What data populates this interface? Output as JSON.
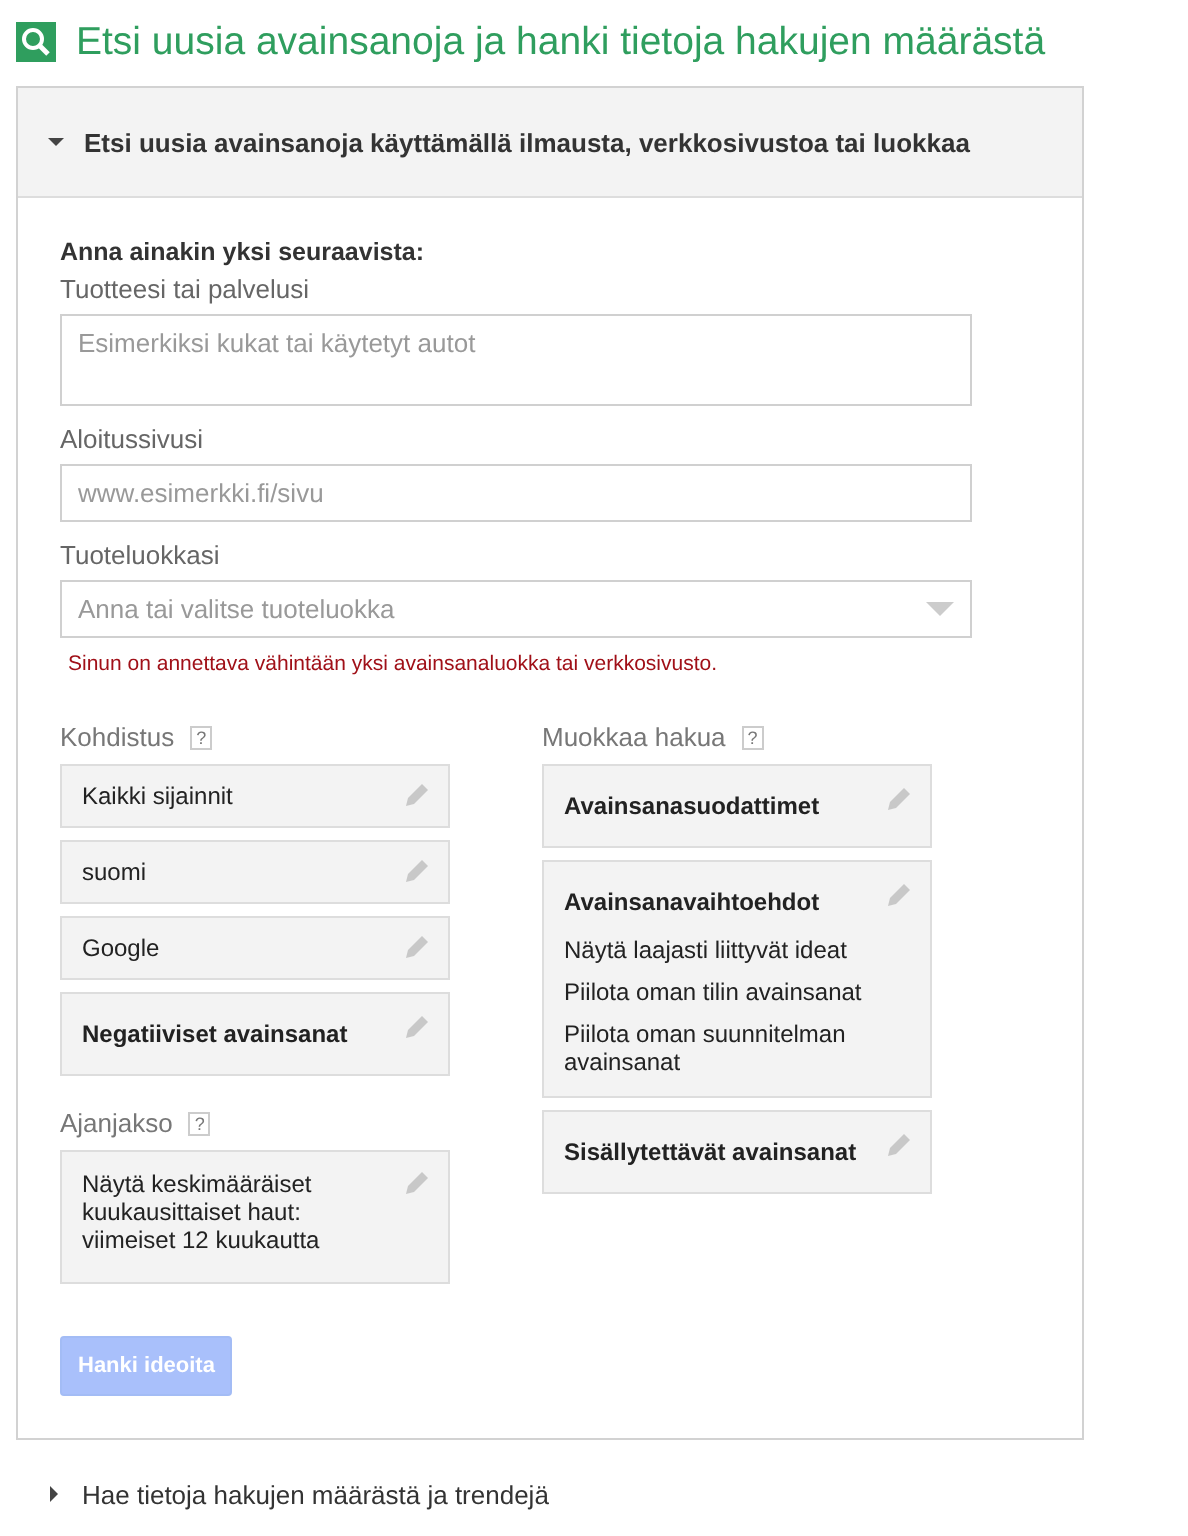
{
  "page_title": "Etsi uusia avainsanoja ja hanki tietoja hakujen määrästä",
  "sections": [
    {
      "title": "Etsi uusia avainsanoja käyttämällä ilmausta, verkkosivustoa tai luokkaa",
      "expanded": true
    },
    {
      "title": "Hae tietoja hakujen määrästä ja trendejä",
      "expanded": false
    }
  ],
  "form": {
    "intro": "Anna ainakin yksi seuraavista:",
    "fields": [
      {
        "kind": "textarea",
        "label": "Tuotteesi tai palvelusi",
        "placeholder": "Esimerkiksi kukat tai käytetyt autot"
      },
      {
        "kind": "input",
        "label": "Aloitussivusi",
        "placeholder": "www.esimerkki.fi/sivu"
      },
      {
        "kind": "dropdown",
        "label": "Tuoteluokkasi",
        "placeholder": "Anna tai valitse tuoteluokka"
      }
    ],
    "error": "Sinun on annettava vähintään yksi avainsanaluokka tai verkkosivusto."
  },
  "columns": [
    [
      {
        "title": "Kohdistus",
        "help": "?",
        "cards": [
          {
            "kind": "value",
            "text": "Kaikki sijainnit"
          },
          {
            "kind": "value",
            "text": "suomi"
          },
          {
            "kind": "value",
            "text": "Google"
          },
          {
            "kind": "heading",
            "text": "Negatiiviset avainsanat"
          }
        ]
      },
      {
        "title": "Ajanjakso",
        "help": "?",
        "cards": [
          {
            "kind": "paragraph",
            "text": "Näytä keskimääräiset kuukausittaiset haut: viimeiset 12 kuukautta"
          }
        ]
      }
    ],
    [
      {
        "title": "Muokkaa hakua",
        "help": "?",
        "cards": [
          {
            "kind": "heading",
            "text": "Avainsanasuodattimet"
          },
          {
            "kind": "heading",
            "text": "Avainsanavaihtoehdot",
            "lines": [
              "Näytä laajasti liittyvät ideat",
              "Piilota oman tilin avainsanat",
              "Piilota oman suunnitelman avainsanat"
            ]
          },
          {
            "kind": "heading",
            "text": "Sisällytettävät avainsanat"
          }
        ]
      }
    ]
  ],
  "submit": {
    "label": "Hanki ideoita",
    "disabled": true
  }
}
